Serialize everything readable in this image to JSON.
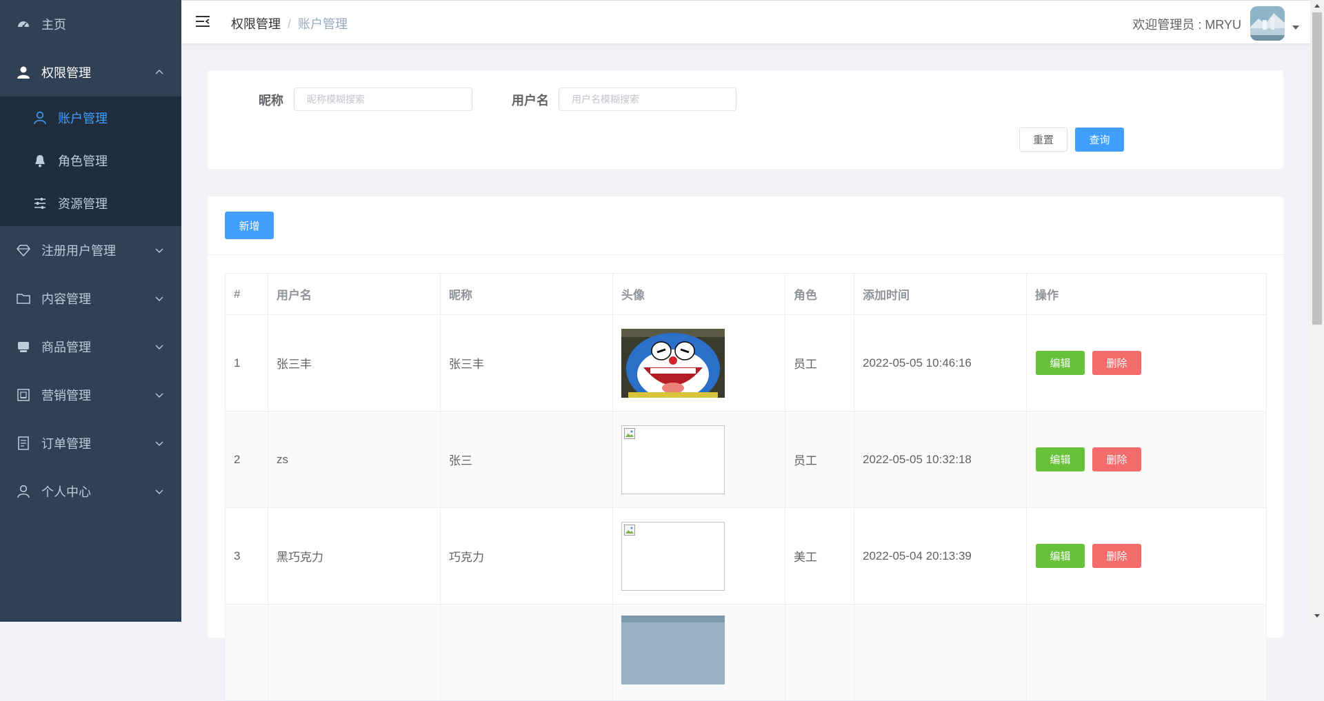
{
  "sidebar": {
    "items": [
      {
        "label": "主页",
        "icon": "dashboard-icon"
      },
      {
        "label": "权限管理",
        "icon": "user-icon",
        "open": true
      },
      {
        "label": "注册用户管理",
        "icon": "diamond-icon"
      },
      {
        "label": "内容管理",
        "icon": "folder-icon"
      },
      {
        "label": "商品管理",
        "icon": "goods-icon"
      },
      {
        "label": "营销管理",
        "icon": "marketing-icon"
      },
      {
        "label": "订单管理",
        "icon": "order-icon"
      },
      {
        "label": "个人中心",
        "icon": "person-icon"
      }
    ],
    "submenu": [
      {
        "label": "账户管理",
        "icon": "user-outline-icon",
        "active": true
      },
      {
        "label": "角色管理",
        "icon": "bell-icon"
      },
      {
        "label": "资源管理",
        "icon": "sliders-icon"
      }
    ]
  },
  "header": {
    "breadcrumb": [
      "权限管理",
      "账户管理"
    ],
    "breadcrumb_sep": "/",
    "welcome": "欢迎管理员 : MRYU"
  },
  "search": {
    "nickname_label": "昵称",
    "nickname_placeholder": "昵称模糊搜索",
    "username_label": "用户名",
    "username_placeholder": "用户名模糊搜索",
    "reset_label": "重置",
    "query_label": "查询"
  },
  "toolbar": {
    "add_label": "新增"
  },
  "table": {
    "columns": [
      "#",
      "用户名",
      "昵称",
      "头像",
      "角色",
      "添加时间",
      "操作"
    ],
    "edit_label": "编辑",
    "delete_label": "删除",
    "rows": [
      {
        "index": "1",
        "username": "张三丰",
        "nickname": "张三丰",
        "avatar": "doraemon",
        "role": "员工",
        "created": "2022-05-05 10:46:16"
      },
      {
        "index": "2",
        "username": "zs",
        "nickname": "张三",
        "avatar": "broken",
        "role": "员工",
        "created": "2022-05-05 10:32:18"
      },
      {
        "index": "3",
        "username": "黑巧克力",
        "nickname": "巧克力",
        "avatar": "broken",
        "role": "美工",
        "created": "2022-05-04 20:13:39"
      }
    ]
  },
  "colors": {
    "sidebar_bg": "#304156",
    "submenu_bg": "#1f2d3d",
    "sidebar_text": "#bfcbd9",
    "active": "#409eff",
    "success": "#67c23a",
    "danger": "#f56c6c"
  }
}
